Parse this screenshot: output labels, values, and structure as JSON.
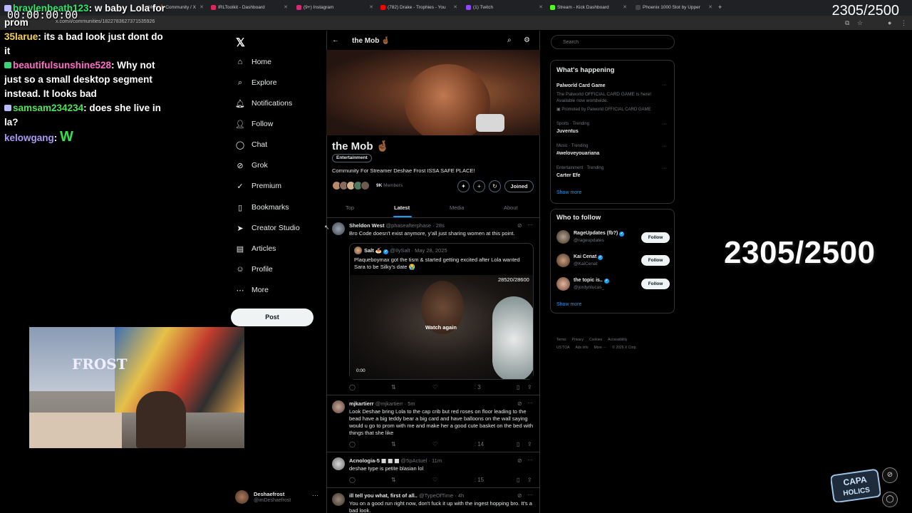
{
  "browser": {
    "tabs": [
      {
        "label": "Mob 🤞🏾 Community / X",
        "color": "#333333"
      },
      {
        "label": "IRLToolkit - Dashboard",
        "color": "#e0245e"
      },
      {
        "label": "(9+) Instagram",
        "color": "#d62976"
      },
      {
        "label": "(782) Drake - Trophies - You",
        "color": "#ff0000"
      },
      {
        "label": "(1) Twitch",
        "color": "#9146ff"
      },
      {
        "label": "Stream - Kick Dashboard",
        "color": "#53fc18"
      },
      {
        "label": "Phoenix 1000 Slot by Upper",
        "color": "#444444"
      }
    ],
    "url": "x.com/i/communities/1822783627371535926"
  },
  "overlay": {
    "timer": "00:00:00:00",
    "counter": "2305/2500",
    "chat": [
      {
        "user": "braylenbeath123",
        "text": "w baby Lola for prom"
      },
      {
        "user": "35larue",
        "text": "its a bad look just dont do it"
      },
      {
        "user": "beautifulsunshine528",
        "text": "Why not just so a small desktop segment instead. It looks bad"
      },
      {
        "user": "samsam234234",
        "text": "does she live in la?"
      },
      {
        "user": "kelowgang",
        "text": "W"
      }
    ],
    "webcam_text": "FROST"
  },
  "nav": {
    "items": [
      {
        "label": "Home",
        "icon": "home-icon"
      },
      {
        "label": "Explore",
        "icon": "search-icon"
      },
      {
        "label": "Notifications",
        "icon": "bell-icon"
      },
      {
        "label": "Follow",
        "icon": "follow-icon"
      },
      {
        "label": "Chat",
        "icon": "chat-icon"
      },
      {
        "label": "Grok",
        "icon": "grok-icon"
      },
      {
        "label": "Premium",
        "icon": "premium-icon"
      },
      {
        "label": "Bookmarks",
        "icon": "bookmark-icon"
      },
      {
        "label": "Creator Studio",
        "icon": "creator-studio-icon"
      },
      {
        "label": "Articles",
        "icon": "articles-icon"
      },
      {
        "label": "Profile",
        "icon": "profile-icon"
      },
      {
        "label": "More",
        "icon": "more-icon"
      }
    ],
    "post_label": "Post",
    "account": {
      "name": "Deshaefrost",
      "handle": "@imDeshaefrost"
    }
  },
  "community": {
    "header_title": "the Mob 🤞🏾",
    "name": "the Mob 🤞🏾",
    "category": "Entertainment",
    "description": "Community For Streamer Deshae Frost ISSA SAFE PLACE!",
    "members_count": "9K",
    "members_label": "Members",
    "joined_label": "Joined",
    "tabs": [
      "Top",
      "Latest",
      "Media",
      "About"
    ],
    "active_tab": "Latest"
  },
  "posts": [
    {
      "name": "Sheldon West",
      "handle": "@phaseafterphase",
      "time": "28s",
      "text": "Bro Code doesn't exist anymore, y'all just sharing women at this point.",
      "quote": {
        "name": "Salt 🍝",
        "handle": "@IlySalt",
        "date": "May 28, 2025",
        "text": "Plaqueboymax got the tism & started getting excited after Lola wanted Sara to be Silky's date 😭",
        "video_counter": "28520/28600",
        "watch_again": "Watch again",
        "video_time": "0:00"
      },
      "views": "3"
    },
    {
      "name": "mjkartierr",
      "handle": "@mjkartierr",
      "time": "5m",
      "text": "Look Deshae  bring Lola to the cap crib but red roses on floor leading to the bead have a big teddy bear a big card and have balloons on the wall saying would u go to prom with me and make her a good cute basket on the bed with things that she like",
      "views": "14"
    },
    {
      "name": "Acnologia-5 ▦ ▦ ▦",
      "handle": "@5pActuel",
      "time": "11m",
      "text": "deshae type is petite blasian lol",
      "views": "15"
    },
    {
      "name": "ill tell you what, first of all..",
      "handle": "@TypeOfTime",
      "time": "4h",
      "text": "You on a good run right now, don't fuck it up with the ingest hopping bro. It's a bad look."
    }
  ],
  "sidebar": {
    "search_placeholder": "Search",
    "whats_happening_title": "What's happening",
    "trends": [
      {
        "meta": "",
        "name": "Palworld Card Game",
        "desc": "The Palworld OFFICIAL CARD GAME is here! Available now worldwide.",
        "promo": "Promoted by Palworld OFFICIAL CARD GAME"
      },
      {
        "meta": "Sports · Trending",
        "name": "Juventus"
      },
      {
        "meta": "Music · Trending",
        "name": "#weloveyouariana"
      },
      {
        "meta": "Entertainment · Trending",
        "name": "Carter Efe"
      }
    ],
    "show_more": "Show more",
    "who_to_follow_title": "Who to follow",
    "who_to_follow": [
      {
        "name": "RageUpdates (fb?)",
        "handle": "@rageupdates",
        "follow": "Follow"
      },
      {
        "name": "Kai Cenat",
        "handle": "@KaiCenat",
        "follow": "Follow"
      },
      {
        "name": "the topic is..",
        "handle": "@jordynlucas_",
        "follow": "Follow"
      }
    ],
    "footer": [
      "Terms",
      "Privacy",
      "Cookies",
      "Accessibility",
      "US TOA",
      "Ads info",
      "More ···",
      "© 2026 X Corp."
    ]
  },
  "logo_text": "CAPA HOLICS"
}
